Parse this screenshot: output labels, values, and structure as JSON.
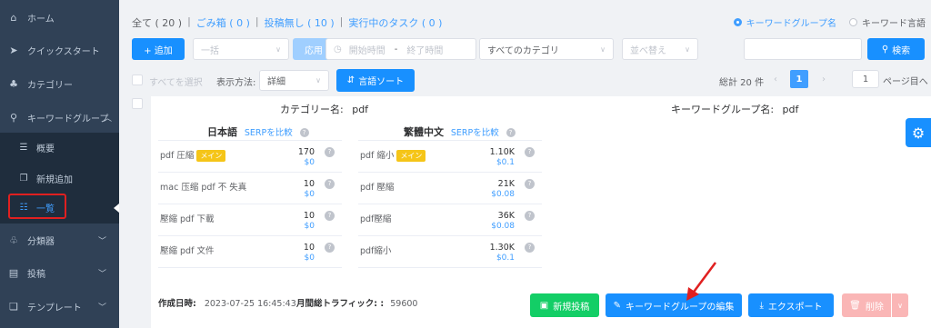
{
  "sidebar": {
    "items": [
      {
        "label": "ホーム",
        "icon": "home-icon",
        "glyph": "⌂"
      },
      {
        "label": "クイックスタート",
        "icon": "send-icon",
        "glyph": "➤"
      },
      {
        "label": "カテゴリー",
        "icon": "category-icon",
        "glyph": "♣"
      },
      {
        "label": "キーワードグループ",
        "icon": "search-icon",
        "glyph": "⚲"
      }
    ],
    "sub_items": [
      {
        "label": "概要",
        "icon": "overview-icon",
        "glyph": "☰"
      },
      {
        "label": "新規追加",
        "icon": "add-doc-icon",
        "glyph": "❐"
      },
      {
        "label": "一覧",
        "icon": "list-icon",
        "glyph": "☷"
      }
    ],
    "lower_items": [
      {
        "label": "分類器",
        "icon": "classifier-icon",
        "glyph": "♧"
      },
      {
        "label": "投稿",
        "icon": "post-icon",
        "glyph": "▤"
      },
      {
        "label": "テンプレート",
        "icon": "template-icon",
        "glyph": "❏"
      }
    ]
  },
  "filter_tabs": [
    {
      "label": "全て ( 20 )"
    },
    {
      "label": "ごみ箱 ( 0 )"
    },
    {
      "label": "投稿無し ( 10 )"
    },
    {
      "label": "実行中のタスク ( 0 )"
    }
  ],
  "search_mode": {
    "option1": "キーワードグループ名",
    "option2": "キーワード言語"
  },
  "toolbar": {
    "add_label": "+ 追加",
    "bulk_placeholder": "一括",
    "apply_label": "応用",
    "start_time": "開始時間",
    "time_sep": "-",
    "end_time": "終了時間",
    "category_value": "すべてのカテゴリ",
    "sort_placeholder": "並べ替え",
    "search_label": "検索"
  },
  "view_bar": {
    "select_all": "すべてを選択",
    "display_label": "表示方法:",
    "display_value": "詳細",
    "lang_sort": "言語ソート"
  },
  "pagination": {
    "total": "総計 20 件",
    "current": "1",
    "goto_value": "1",
    "goto_suffix": "ページ目へ"
  },
  "card": {
    "category_label": "カテゴリー名:",
    "category_value": "pdf",
    "group_label": "キーワードグループ名:",
    "group_value": "pdf",
    "lang1": "日本語",
    "lang2": "繁體中文",
    "serp": "SERPを比較",
    "main_badge": "メイン",
    "jp_rows": [
      {
        "name": "pdf 圧縮",
        "main": true,
        "vol": "170",
        "cpc": "$0"
      },
      {
        "name": "mac 压缩 pdf 不 失真",
        "main": false,
        "vol": "10",
        "cpc": "$0"
      },
      {
        "name": "壓縮 pdf 下載",
        "main": false,
        "vol": "10",
        "cpc": "$0"
      },
      {
        "name": "壓縮 pdf 文件",
        "main": false,
        "vol": "10",
        "cpc": "$0"
      }
    ],
    "tw_rows": [
      {
        "name": "pdf 縮小",
        "main": true,
        "vol": "1.10K",
        "cpc": "$0.1"
      },
      {
        "name": "pdf 壓縮",
        "main": false,
        "vol": "21K",
        "cpc": "$0.08"
      },
      {
        "name": "pdf壓縮",
        "main": false,
        "vol": "36K",
        "cpc": "$0.08"
      },
      {
        "name": "pdf縮小",
        "main": false,
        "vol": "1.30K",
        "cpc": "$0.1"
      }
    ],
    "created_label": "作成日時:",
    "created_value": "2023-07-25 16:45:43",
    "traffic_label": "月間総トラフィック: :",
    "traffic_value": "59600"
  },
  "actions": {
    "new_post": "新規投稿",
    "edit_group": "キーワードグループの編集",
    "export": "エクスポート",
    "delete": "削除"
  },
  "colors": {
    "primary": "#1890ff",
    "success": "#13ce66",
    "danger_disabled": "#fab6b6",
    "sidebar": "#304156",
    "annotation_red": "#e02020"
  }
}
